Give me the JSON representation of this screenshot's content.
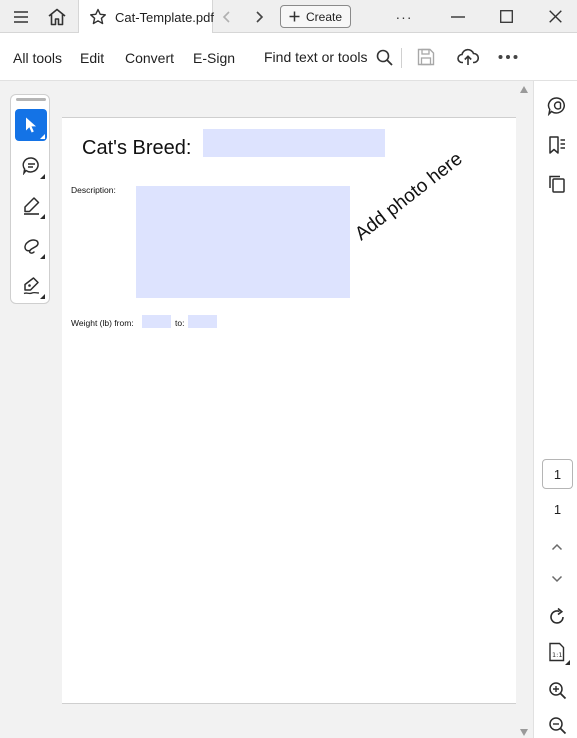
{
  "window": {
    "tab_title": "Cat-Template.pdf",
    "create_label": "Create",
    "more_label": "···"
  },
  "toolbar": {
    "items": [
      "All tools",
      "Edit",
      "Convert",
      "E-Sign"
    ],
    "find_label": "Find text or tools"
  },
  "tools": [
    "select-icon",
    "comment-icon",
    "highlight-icon",
    "draw-icon",
    "sign-icon"
  ],
  "document": {
    "breed_label": "Cat's Breed:",
    "description_label": "Description:",
    "photo_placeholder": "Add photo here",
    "weight_label": "Weight (lb) from:",
    "to_label": "to:"
  },
  "navigation": {
    "current_page": "1",
    "total_pages": "1"
  },
  "colors": {
    "accent": "#1473e6",
    "form_field": "#dde3fe"
  }
}
